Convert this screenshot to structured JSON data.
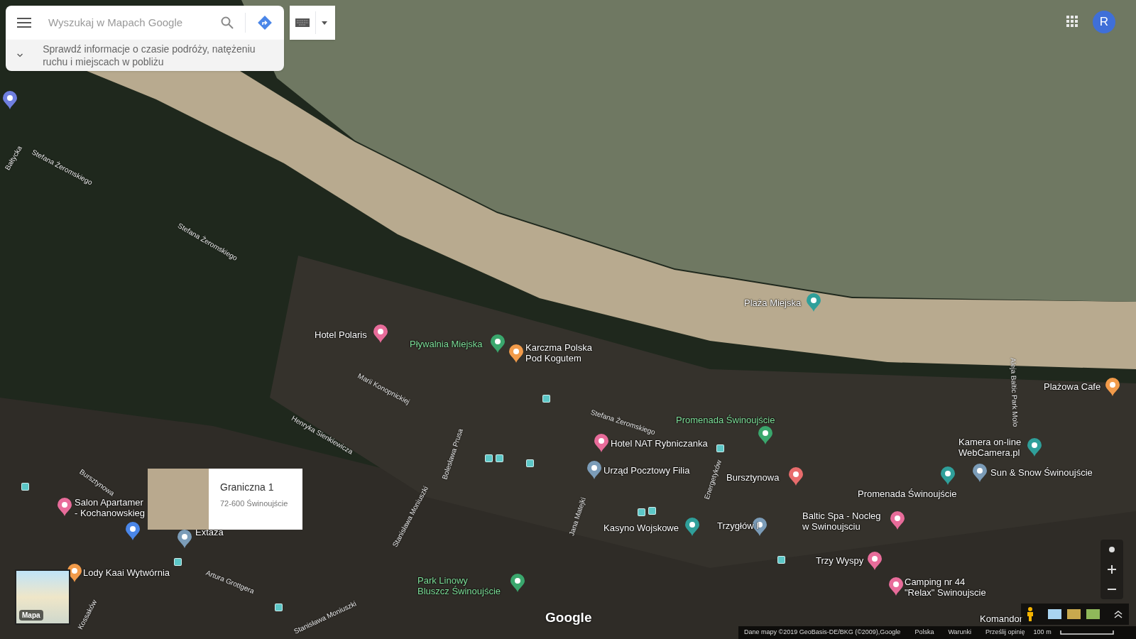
{
  "search_box": {
    "placeholder": "Wyszukaj w Mapach Google"
  },
  "info_banner": {
    "text": "Sprawdź informacje o czasie podróży, natężeniu ruchu i miejscach w pobliżu"
  },
  "account": {
    "initial": "R"
  },
  "map": {
    "pois": [
      {
        "lines": [
          "Hotel Polaris"
        ],
        "kind": "hotel"
      },
      {
        "lines": [
          "Pływalnia Miejska"
        ],
        "kind": "recreation"
      },
      {
        "lines": [
          "Karczma Polska",
          "Pod Kogutem"
        ],
        "kind": "food"
      },
      {
        "lines": [
          "Plaża Miejska"
        ],
        "kind": "attraction"
      },
      {
        "lines": [
          "Plażowa Cafe"
        ],
        "kind": "food"
      },
      {
        "lines": [
          "Promenada Świnoujście"
        ],
        "kind": "recreation"
      },
      {
        "lines": [
          "Hotel NAT Rybniczanka"
        ],
        "kind": "hotel"
      },
      {
        "lines": [
          "Kamera on-line",
          "WebCamera.pl"
        ],
        "kind": "attraction"
      },
      {
        "lines": [
          "Urząd Pocztowy Filia"
        ],
        "kind": "place"
      },
      {
        "lines": [
          "Bursztynowa"
        ],
        "kind": "shop"
      },
      {
        "lines": [
          "Sun & Snow Świnoujście"
        ],
        "kind": "place"
      },
      {
        "lines": [
          "Promenada Świnoujście"
        ],
        "kind": "area"
      },
      {
        "lines": [
          "Kasyno Wojskowe"
        ],
        "kind": "attraction"
      },
      {
        "lines": [
          "Trzygłów I"
        ],
        "kind": "place"
      },
      {
        "lines": [
          "Baltic Spa - Nocleg",
          "w Swinoujsciu"
        ],
        "kind": "hotel"
      },
      {
        "lines": [
          "Salon Apartamer",
          "- Kochanowskieg"
        ],
        "kind": "hotel"
      },
      {
        "lines": [
          "Extaza"
        ],
        "kind": "place"
      },
      {
        "lines": [
          "Trzy Wyspy"
        ],
        "kind": "hotel"
      },
      {
        "lines": [
          "Lody Kaai Wytwórnia"
        ],
        "kind": "food"
      },
      {
        "lines": [
          "Park Linowy",
          "Bluszcz Świnoujście"
        ],
        "kind": "recreation"
      },
      {
        "lines": [
          "Camping nr 44",
          "\"Relax\" Swinoujscie"
        ],
        "kind": "hotel"
      },
      {
        "lines": [
          "Komandor"
        ],
        "kind": "area"
      }
    ],
    "unlabeled_pins": [
      {
        "kind": "parking"
      },
      {
        "kind": "attraction"
      },
      {
        "kind": "home"
      }
    ],
    "streets": [
      "Bałtycka",
      "Stefana Żeromskiego",
      "Stefana Żeromskiego",
      "Marii Konopnickiej",
      "Henryka Sienkiewicza",
      "Bolesława Prusa",
      "Stanisława Moniuszki",
      "Stefana Żeromskiego",
      "Jana Matejki",
      "Energetyków",
      "Bursztynowa",
      "Artura Grottgera",
      "Stanisława Moniuszki",
      "Kossaków",
      "Aleja Baltic Park Molo"
    ]
  },
  "place_card": {
    "title": "Graniczna 1",
    "address": "72-600 Świnoujście"
  },
  "layer_switcher": {
    "label": "Mapa"
  },
  "logo": "Google",
  "footer": {
    "items": [
      "Dane mapy ©2019 GeoBasis-DE/BKG (©2009),Google",
      "Polska",
      "Warunki",
      "Prześlij opinię"
    ],
    "scale": "100 m"
  }
}
